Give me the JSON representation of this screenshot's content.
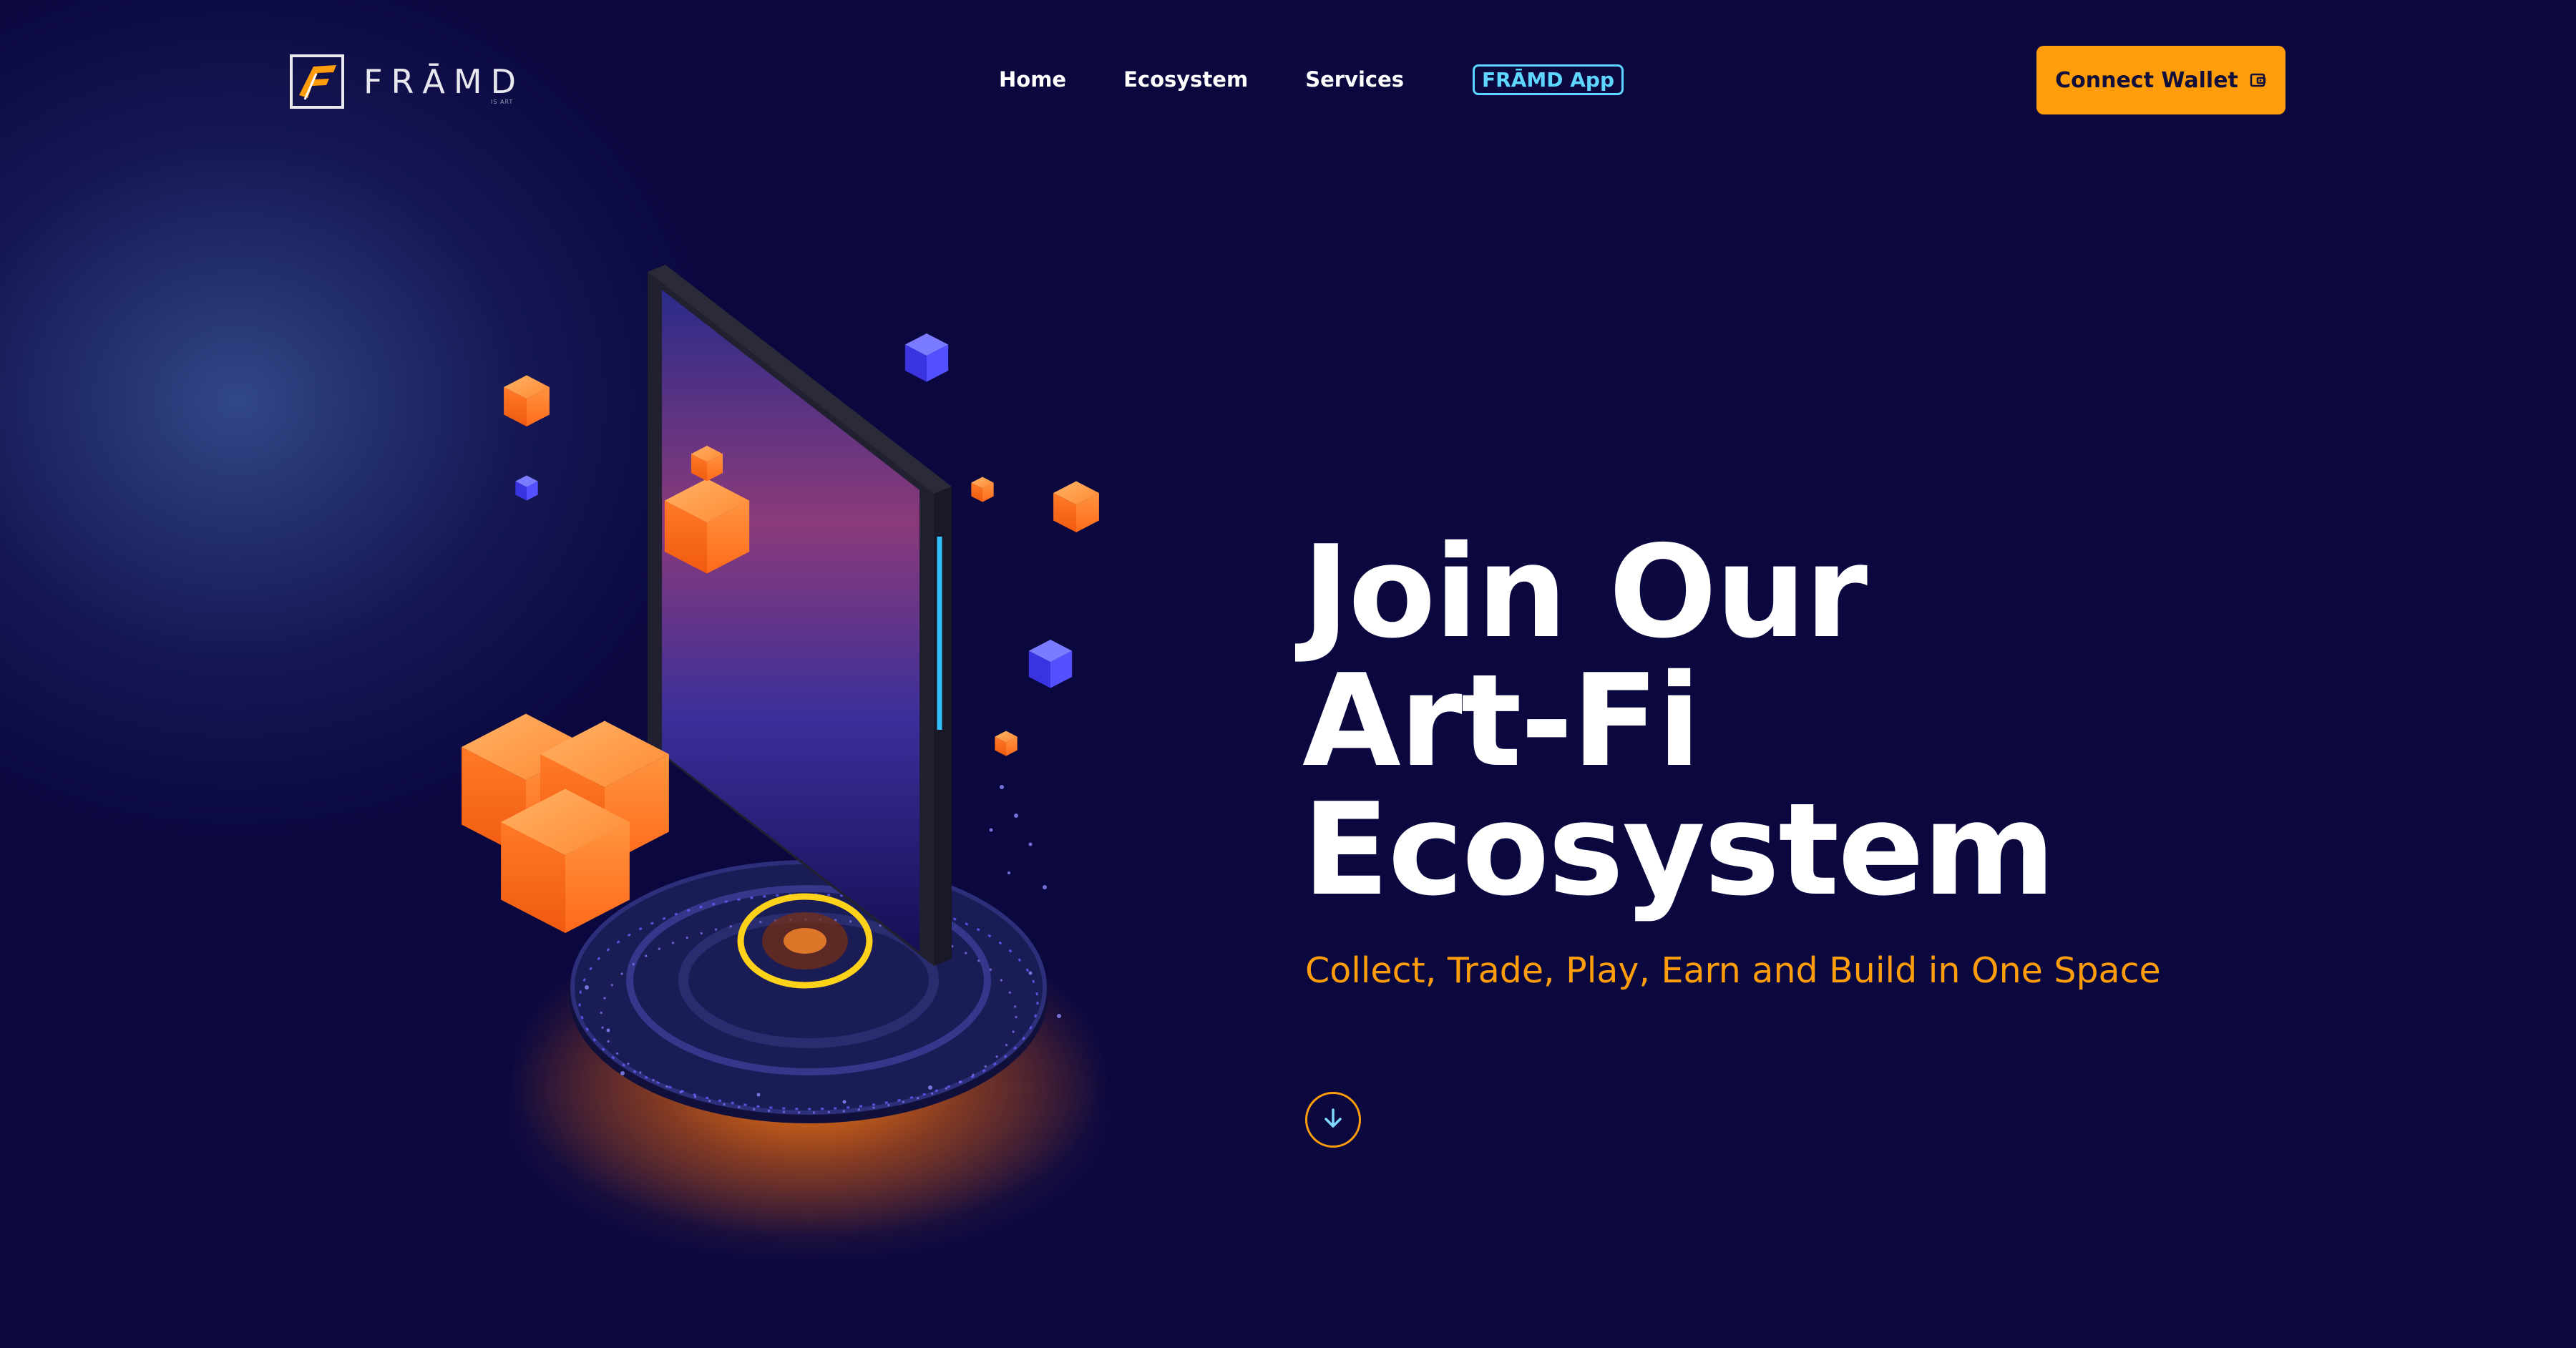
{
  "brand": {
    "name": "FRĀMD",
    "tagline": "IS ART",
    "logo_icon": "framd-f-icon",
    "accent": "#ff9d0a",
    "highlight": "#5fd6ff",
    "background": "#0b0840"
  },
  "nav": {
    "items": [
      {
        "label": "Home"
      },
      {
        "label": "Ecosystem"
      },
      {
        "label": "Services"
      }
    ],
    "app_label": "FRĀMD App"
  },
  "header": {
    "connect_label": "Connect Wallet",
    "connect_icon": "wallet-icon"
  },
  "hero": {
    "title_lines": [
      "Join Our",
      "Art-Fi",
      "Ecosystem"
    ],
    "subtitle": "Collect, Trade, Play, Earn and Build in One Space",
    "scroll_icon": "arrow-down-icon"
  },
  "illustration": {
    "icon": "nft-frame-cubes-illustration"
  }
}
